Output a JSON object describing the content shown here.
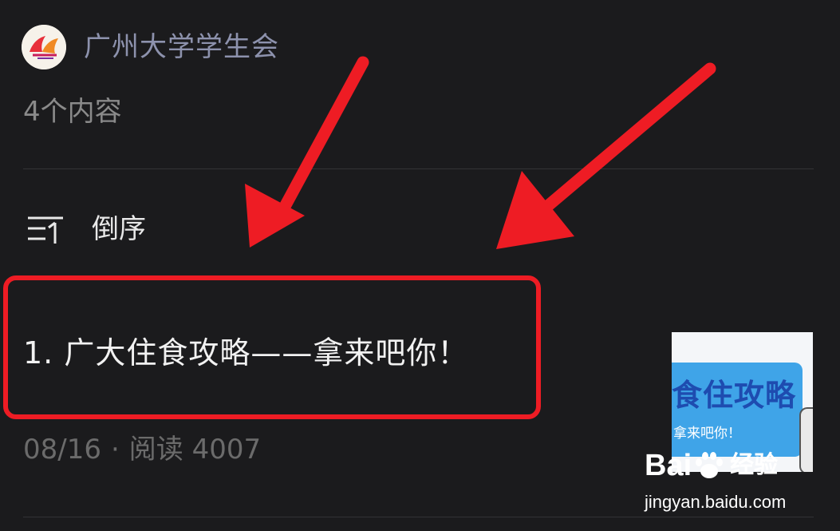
{
  "account": {
    "name": "广州大学学生会",
    "content_count": "4个内容",
    "avatar_icon": "gzu-student-union-logo"
  },
  "sort": {
    "icon": "sort-order-icon",
    "label": "倒序"
  },
  "articles": [
    {
      "title": "1. 广大住食攻略——拿来吧你！",
      "date": "08/16",
      "separator": "·",
      "reads": "阅读 4007",
      "thumbnail": {
        "title": "食住攻略",
        "subtitle": "拿来吧你！"
      }
    }
  ],
  "watermark": {
    "brand_left": "Bai",
    "brand_right": "经验",
    "url": "jingyan.baidu.com"
  },
  "colors": {
    "background": "#1b1b1d",
    "account_name": "#8d92ad",
    "annotation_red": "#ee1c24",
    "thumb_banner": "#3fa4e8"
  }
}
